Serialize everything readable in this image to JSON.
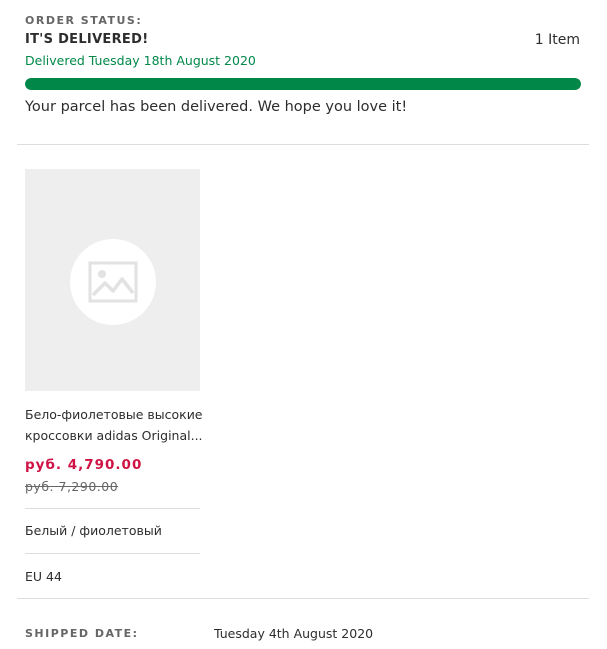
{
  "order_status": {
    "label": "ORDER STATUS:",
    "title": "IT'S DELIVERED!",
    "item_count": "1 Item",
    "delivered_date": "Delivered Tuesday 18th August 2020",
    "progress_percent": 100,
    "message": "Your parcel has been delivered. We hope you love it!"
  },
  "product": {
    "image_icon": "image-placeholder-icon",
    "name_line1": "Бело-фиолетовые высокие",
    "name_line2": "кроссовки adidas Original...",
    "price_now": "руб. 4,790.00",
    "price_was": "руб. 7,290.00",
    "colour": "Белый / фиолетовый",
    "size": "EU 44"
  },
  "shipping": {
    "label": "SHIPPED DATE:",
    "date": "Tuesday 4th August 2020"
  },
  "colors": {
    "accent_green": "#018849",
    "sale_red": "#d01345",
    "muted": "#666666"
  }
}
